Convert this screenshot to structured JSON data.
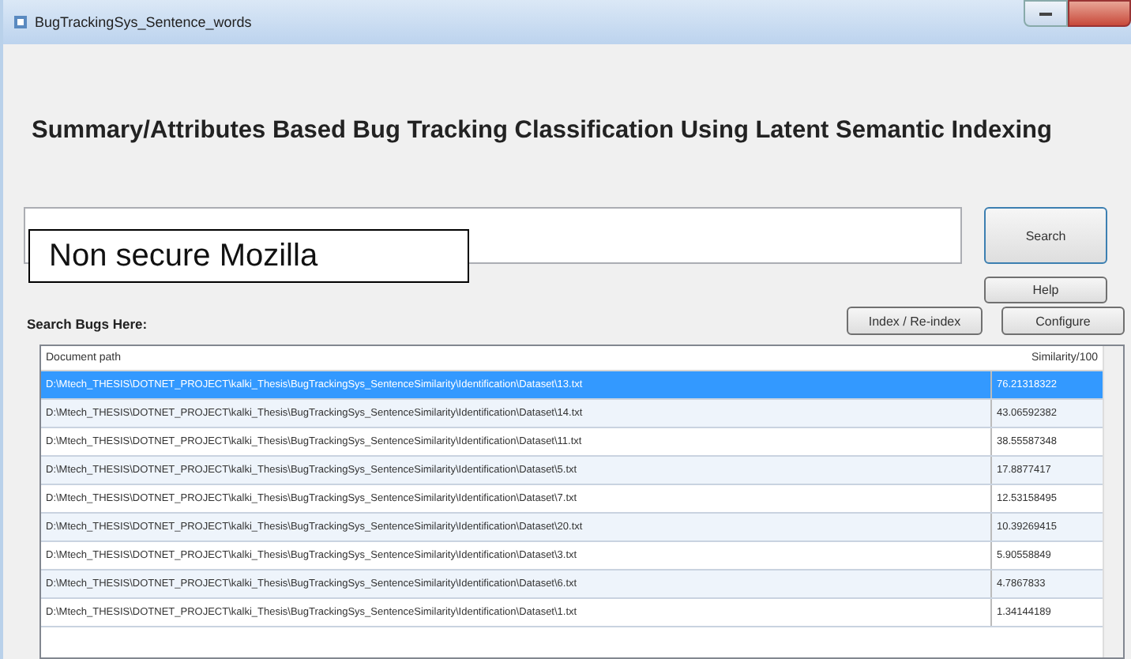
{
  "window": {
    "title": "BugTrackingSys_Sentence_words"
  },
  "heading": "Summary/Attributes Based Bug Tracking Classification Using Latent Semantic Indexing",
  "search": {
    "value": "Non secure Mozilla"
  },
  "buttons": {
    "search": "Search",
    "help": "Help",
    "index": "Index / Re-index",
    "configure": "Configure"
  },
  "search_label": "Search Bugs Here:",
  "table": {
    "columns": [
      "Document path",
      "Similarity/100"
    ],
    "rows": [
      {
        "path": "D:\\Mtech_THESIS\\DOTNET_PROJECT\\kalki_Thesis\\BugTrackingSys_SentenceSimilarity\\Identification\\Dataset\\13.txt",
        "similarity": "76.21318322",
        "selected": true
      },
      {
        "path": "D:\\Mtech_THESIS\\DOTNET_PROJECT\\kalki_Thesis\\BugTrackingSys_SentenceSimilarity\\Identification\\Dataset\\14.txt",
        "similarity": "43.06592382",
        "selected": false
      },
      {
        "path": "D:\\Mtech_THESIS\\DOTNET_PROJECT\\kalki_Thesis\\BugTrackingSys_SentenceSimilarity\\Identification\\Dataset\\11.txt",
        "similarity": "38.55587348",
        "selected": false
      },
      {
        "path": "D:\\Mtech_THESIS\\DOTNET_PROJECT\\kalki_Thesis\\BugTrackingSys_SentenceSimilarity\\Identification\\Dataset\\5.txt",
        "similarity": "17.8877417",
        "selected": false
      },
      {
        "path": "D:\\Mtech_THESIS\\DOTNET_PROJECT\\kalki_Thesis\\BugTrackingSys_SentenceSimilarity\\Identification\\Dataset\\7.txt",
        "similarity": "12.53158495",
        "selected": false
      },
      {
        "path": "D:\\Mtech_THESIS\\DOTNET_PROJECT\\kalki_Thesis\\BugTrackingSys_SentenceSimilarity\\Identification\\Dataset\\20.txt",
        "similarity": "10.39269415",
        "selected": false
      },
      {
        "path": "D:\\Mtech_THESIS\\DOTNET_PROJECT\\kalki_Thesis\\BugTrackingSys_SentenceSimilarity\\Identification\\Dataset\\3.txt",
        "similarity": "5.90558849",
        "selected": false
      },
      {
        "path": "D:\\Mtech_THESIS\\DOTNET_PROJECT\\kalki_Thesis\\BugTrackingSys_SentenceSimilarity\\Identification\\Dataset\\6.txt",
        "similarity": "4.7867833",
        "selected": false
      },
      {
        "path": "D:\\Mtech_THESIS\\DOTNET_PROJECT\\kalki_Thesis\\BugTrackingSys_SentenceSimilarity\\Identification\\Dataset\\1.txt",
        "similarity": "1.34144189",
        "selected": false
      }
    ]
  }
}
